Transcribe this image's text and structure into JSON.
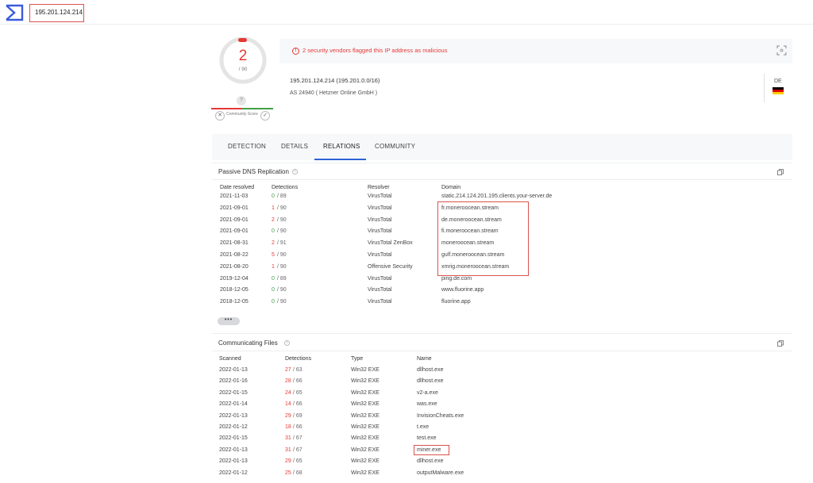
{
  "search": {
    "value": "195.201.124.214"
  },
  "score": {
    "detections": "2",
    "total": "/ 90"
  },
  "community": {
    "question": "?",
    "label": "Community Score"
  },
  "alert": {
    "text": "2 security vendors flagged this IP address as malicious",
    "icon": "!"
  },
  "ip_info": {
    "ip_line": "195.201.124.214  (195.201.0.0/16)",
    "as_line": "AS 24940 ( Hetzner Online GmbH )",
    "country_code": "DE"
  },
  "tabs": [
    {
      "label": "DETECTION"
    },
    {
      "label": "DETAILS"
    },
    {
      "label": "RELATIONS"
    },
    {
      "label": "COMMUNITY"
    }
  ],
  "dns": {
    "title": "Passive DNS Replication",
    "info": "i",
    "headers": [
      "Date resolved",
      "Detections",
      "Resolver",
      "Domain"
    ],
    "rows": [
      {
        "date": "2021-11-03",
        "det": "0",
        "total": "/ 89",
        "resolver": "VirusTotal",
        "domain": "static.214.124.201.195.clients.your-server.de"
      },
      {
        "date": "2021-09-01",
        "det": "1",
        "total": "/ 90",
        "resolver": "VirusTotal",
        "domain": "fr.moneroocean.stream"
      },
      {
        "date": "2021-09-01",
        "det": "2",
        "total": "/ 90",
        "resolver": "VirusTotal",
        "domain": "de.moneroocean.stream"
      },
      {
        "date": "2021-09-01",
        "det": "0",
        "total": "/ 90",
        "resolver": "VirusTotal",
        "domain": "fi.moneroocean.stream"
      },
      {
        "date": "2021-08-31",
        "det": "2",
        "total": "/ 91",
        "resolver": "VirusTotal ZenBox",
        "domain": "moneroocean.stream"
      },
      {
        "date": "2021-08-22",
        "det": "5",
        "total": "/ 90",
        "resolver": "VirusTotal",
        "domain": "gulf.moneroocean.stream"
      },
      {
        "date": "2021-08-20",
        "det": "1",
        "total": "/ 90",
        "resolver": "Offensive Security",
        "domain": "xmrig.moneroocean.stream"
      },
      {
        "date": "2019-12-04",
        "det": "0",
        "total": "/ 89",
        "resolver": "VirusTotal",
        "domain": "ping.de.com"
      },
      {
        "date": "2018-12-05",
        "det": "0",
        "total": "/ 90",
        "resolver": "VirusTotal",
        "domain": "www.fluorine.app"
      },
      {
        "date": "2018-12-05",
        "det": "0",
        "total": "/ 90",
        "resolver": "VirusTotal",
        "domain": "fluorine.app"
      }
    ],
    "more": "•••"
  },
  "files": {
    "title": "Communicating Files",
    "info": "i",
    "headers": [
      "Scanned",
      "Detections",
      "Type",
      "Name"
    ],
    "rows": [
      {
        "date": "2022-01-13",
        "det": "27",
        "total": "/ 63",
        "type": "Win32 EXE",
        "name": "dllhost.exe"
      },
      {
        "date": "2022-01-16",
        "det": "28",
        "total": "/ 66",
        "type": "Win32 EXE",
        "name": "dllhost.exe"
      },
      {
        "date": "2022-01-15",
        "det": "24",
        "total": "/ 65",
        "type": "Win32 EXE",
        "name": "v2-a.exe"
      },
      {
        "date": "2022-01-14",
        "det": "14",
        "total": "/ 66",
        "type": "Win32 EXE",
        "name": "was.exe"
      },
      {
        "date": "2022-01-13",
        "det": "29",
        "total": "/ 69",
        "type": "Win32 EXE",
        "name": "InvisionCheats.exe"
      },
      {
        "date": "2022-01-12",
        "det": "18",
        "total": "/ 66",
        "type": "Win32 EXE",
        "name": "t.exe"
      },
      {
        "date": "2022-01-15",
        "det": "31",
        "total": "/ 67",
        "type": "Win32 EXE",
        "name": "test.exe"
      },
      {
        "date": "2022-01-13",
        "det": "31",
        "total": "/ 67",
        "type": "Win32 EXE",
        "name": "miner.exe"
      },
      {
        "date": "2022-01-13",
        "det": "29",
        "total": "/ 65",
        "type": "Win32 EXE",
        "name": "dllhost.exe"
      },
      {
        "date": "2022-01-12",
        "det": "25",
        "total": "/ 68",
        "type": "Win32 EXE",
        "name": "outputMalware.exe"
      }
    ]
  },
  "colors": {
    "malicious": "#e53935",
    "clean": "#43a047",
    "accent": "#2f63d6",
    "highlight": "#d9534f"
  }
}
